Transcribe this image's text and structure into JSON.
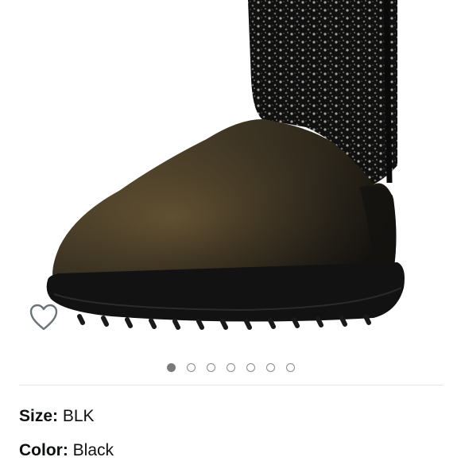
{
  "gallery": {
    "image_icon": "boot-product-image",
    "wishlist_icon": "heart-outline-icon",
    "dots": [
      {
        "active": true
      },
      {
        "active": false
      },
      {
        "active": false
      },
      {
        "active": false
      },
      {
        "active": false
      },
      {
        "active": false
      },
      {
        "active": false
      }
    ]
  },
  "attributes": {
    "size_label": "Size:",
    "size_value": "BLK",
    "color_label": "Color:",
    "color_value": "Black"
  },
  "colors": {
    "text": "#0f1111",
    "dot_active": "#7a7a7a",
    "divider": "#e3e3e3"
  }
}
